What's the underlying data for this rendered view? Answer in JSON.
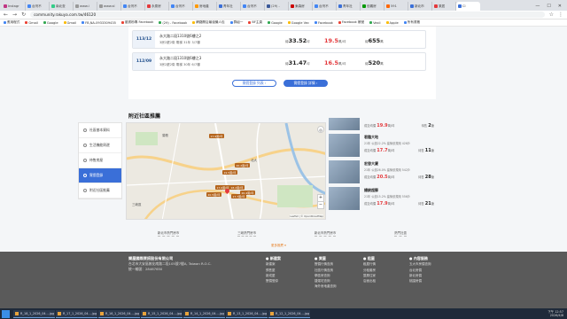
{
  "browser": {
    "tabs": [
      {
        "label": "Instagr",
        "color": "#c13584"
      },
      {
        "label": "台灣不",
        "color": "#4285f4"
      },
      {
        "label": "南北查",
        "color": "#3c8"
      },
      {
        "label": "www.i",
        "color": "#999"
      },
      {
        "label": "www.sl",
        "color": "#999"
      },
      {
        "label": "台灣不",
        "color": "#4285f4"
      },
      {
        "label": "永慶房",
        "color": "#e4393c"
      },
      {
        "label": "台灣不",
        "color": "#4285f4"
      },
      {
        "label": "房地產",
        "color": "#f90"
      },
      {
        "label": "青年社",
        "color": "#3a6fd8"
      },
      {
        "label": "台灣不",
        "color": "#4285f4"
      },
      {
        "label": "(29) -",
        "color": "#3b5998"
      },
      {
        "label": "東森房",
        "color": "#c00"
      },
      {
        "label": "台灣不",
        "color": "#4285f4"
      },
      {
        "label": "青年社",
        "color": "#3a6fd8"
      },
      {
        "label": "信義房",
        "color": "#090"
      },
      {
        "label": "591",
        "color": "#f60"
      },
      {
        "label": "新北市",
        "color": "#3a6fd8"
      },
      {
        "label": "樂居",
        "color": "#e4393c"
      },
      {
        "label": "Cl",
        "color": "#3a6fd8"
      }
    ],
    "url": "community.rakuya.com.tw/46120",
    "bookmarks": [
      "應用程式",
      "Gmail",
      "Google",
      "Gmail",
      "FB,NA-0933309435",
      "臉書粉專 Facebook",
      "(29) - Facebook",
      "網路開店最強懶人包",
      "群組一",
      "BF主頁",
      "Google",
      "Google Vec",
      "Facebook",
      "Facebook 帳號",
      "Vexil",
      "Apple",
      "所有書籤"
    ]
  },
  "records": [
    {
      "date": "113/12",
      "address": "永大路二段1310號6樓之2",
      "meta": "3房2廳2衛  電梯  31年  3/7樓",
      "area_label": "總",
      "area": "33.52",
      "area_unit": "坪",
      "unit_price": "19.5",
      "unit_price_suffix": "萬/坪",
      "total_label": "總",
      "total": "655",
      "total_unit": "萬"
    },
    {
      "date": "112/09",
      "address": "永大路二段1310號6樓之3",
      "meta": "3房2廳2衛  電梯  30年  6/7樓",
      "area_label": "總",
      "area": "31.47",
      "area_unit": "坪",
      "unit_price": "16.5",
      "unit_price_suffix": "萬/坪",
      "total_label": "總",
      "total": "520",
      "total_unit": "萬"
    }
  ],
  "buttons": {
    "list": "實價登錄 列表 ›",
    "detail": "實價登錄 詳情 ›"
  },
  "nearby_title": "附近社區推薦",
  "sidebar": [
    {
      "label": "社區基本資料",
      "active": false
    },
    {
      "label": "生活機能周邊",
      "active": false
    },
    {
      "label": "待售房屋",
      "active": false
    },
    {
      "label": "實價登錄",
      "active": true
    },
    {
      "label": "附近社區推薦",
      "active": false
    }
  ],
  "map": {
    "markers": [
      "17.9萬/坪",
      "20.2萬/坪",
      "19.5萬/坪",
      "17.0萬/坪",
      "18.2萬/坪",
      "20.5萬/坪",
      "17.7萬/坪",
      "20.4萬/坪"
    ],
    "attribution": "Leaflet | © OpenStreetMap",
    "labels": [
      "三峽區",
      "鶯歌",
      "北大"
    ],
    "zoom_in": "+",
    "zoom_out": "−"
  },
  "communities_top": {
    "price_label": "成交均價",
    "price": "19.9",
    "price_suffix": "萬/坪",
    "count_label": "待售",
    "count": "2",
    "count_unit": "筆"
  },
  "communities": [
    {
      "name": "君臨大地",
      "summary": "21年  公設22.2%  建築依規用 426戶",
      "price_label": "成交均價",
      "price": "17.7",
      "price_suffix": "萬/坪",
      "count_label": "待售",
      "count": "11",
      "count_unit": "筆"
    },
    {
      "name": "宏發大廈",
      "summary": "21年  公設26.0%  建築依規用 542戶",
      "price_label": "成交均價",
      "price": "20.5",
      "price_suffix": "萬/坪",
      "count_label": "待售",
      "count": "28",
      "count_unit": "筆"
    },
    {
      "name": "總統超郵",
      "summary": "21年  公設15.2%  建築依規用 556戶",
      "price_label": "成交均價",
      "price": "17.9",
      "price_suffix": "萬/坪",
      "count_label": "待售",
      "count": "21",
      "count_unit": "筆"
    }
  ],
  "links": [
    "新北市熱門房市",
    "三峽熱門房市",
    "新北市熱門房市",
    "熱門社區"
  ],
  "more": "更多推薦 ▾",
  "footer": {
    "company": "樂屋國際資訊股份有限公司",
    "address": "台北市大安區敦化南路二段105號7樓A, Taiwan R.O.C.",
    "id": "統一編號：28467650",
    "cols": [
      {
        "title": "● 新建案",
        "items": [
          "新建案",
          "預售屋",
          "新成屋",
          "實價登錄"
        ]
      },
      {
        "title": "● 買屋",
        "items": [
          "實價行情查詢",
          "社區行情查詢",
          "學區房查詢",
          "捷運宅查詢",
          "海外房地產查詢"
        ]
      },
      {
        "title": "● 租屋",
        "items": [
          "租屋行情",
          "分租套房",
          "整層住家",
          "店面出租"
        ]
      },
      {
        "title": "● 內容服務",
        "items": [
          "五大市房價查詢",
          "台北房價",
          "新北房價",
          "桃園房價"
        ]
      }
    ]
  },
  "taskbar": {
    "items": [
      "R_18_1_2026_04....jpg",
      "R_17_1_2026_04....jpg",
      "R_16_1_2026_04....jpg",
      "R_15_1_2026_04....jpg",
      "R_14_1_2026_04....jpg",
      "R_13_1_2026_04....jpg",
      "R_12_1_2026_04....jpg"
    ],
    "time": "下午 12:57",
    "date": "2026/4/8"
  }
}
